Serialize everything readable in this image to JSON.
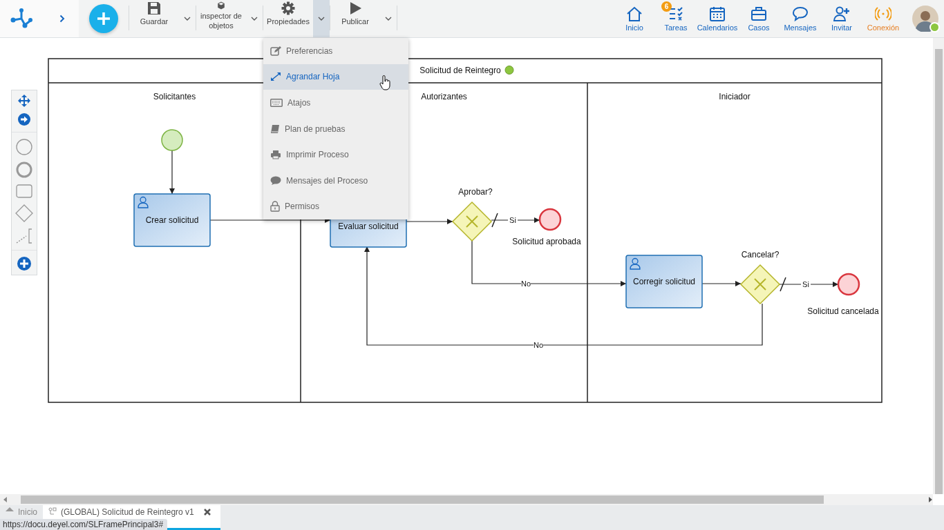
{
  "toolbar": {
    "buttons": [
      {
        "label": "Guardar",
        "expanded": false
      },
      {
        "label": "inspector de objetos",
        "expanded": false
      },
      {
        "label": "Propiedades",
        "expanded": true
      },
      {
        "label": "Publicar",
        "expanded": false
      }
    ]
  },
  "nav": [
    {
      "label": "Inicio"
    },
    {
      "label": "Tareas",
      "badge": "6"
    },
    {
      "label": "Calendarios"
    },
    {
      "label": "Casos"
    },
    {
      "label": "Mensajes"
    },
    {
      "label": "Invitar"
    },
    {
      "label": "Conexión",
      "kind": "connection"
    }
  ],
  "properties_menu": [
    {
      "label": "Preferencias",
      "selected": false
    },
    {
      "label": "Agrandar Hoja",
      "selected": true
    },
    {
      "label": "Atajos",
      "selected": false
    },
    {
      "label": "Plan de pruebas",
      "selected": false
    },
    {
      "label": "Imprimir Proceso",
      "selected": false
    },
    {
      "label": "Mensajes del Proceso",
      "selected": false
    },
    {
      "label": "Permisos",
      "selected": false
    }
  ],
  "diagram": {
    "pool": {
      "title": "Solicitud de Reintegro"
    },
    "lanes": [
      "Solicitantes",
      "Autorizantes",
      "Iniciador"
    ],
    "nodes": [
      {
        "kind": "start"
      },
      {
        "kind": "task",
        "label": "Crear solicitud"
      },
      {
        "kind": "task",
        "label": "Evaluar solicitud"
      },
      {
        "kind": "gateway",
        "label": "Aprobar?"
      },
      {
        "kind": "end",
        "label": "Solicitud aprobada"
      },
      {
        "kind": "task",
        "label": "Corregir solicitud"
      },
      {
        "kind": "gateway",
        "label": "Cancelar?"
      },
      {
        "kind": "end",
        "label": "Solicitud cancelada"
      }
    ],
    "flows": [
      {
        "label": "Si"
      },
      {
        "label": "No"
      },
      {
        "label": "Si"
      },
      {
        "label": "No"
      }
    ]
  },
  "tabs": [
    {
      "label": "Inicio",
      "selected": false
    },
    {
      "label": "(GLOBAL) Solicitud de Reintegro v1",
      "selected": true
    }
  ],
  "status_url": "https://docu.deyel.com/SLFramePrincipal3#"
}
